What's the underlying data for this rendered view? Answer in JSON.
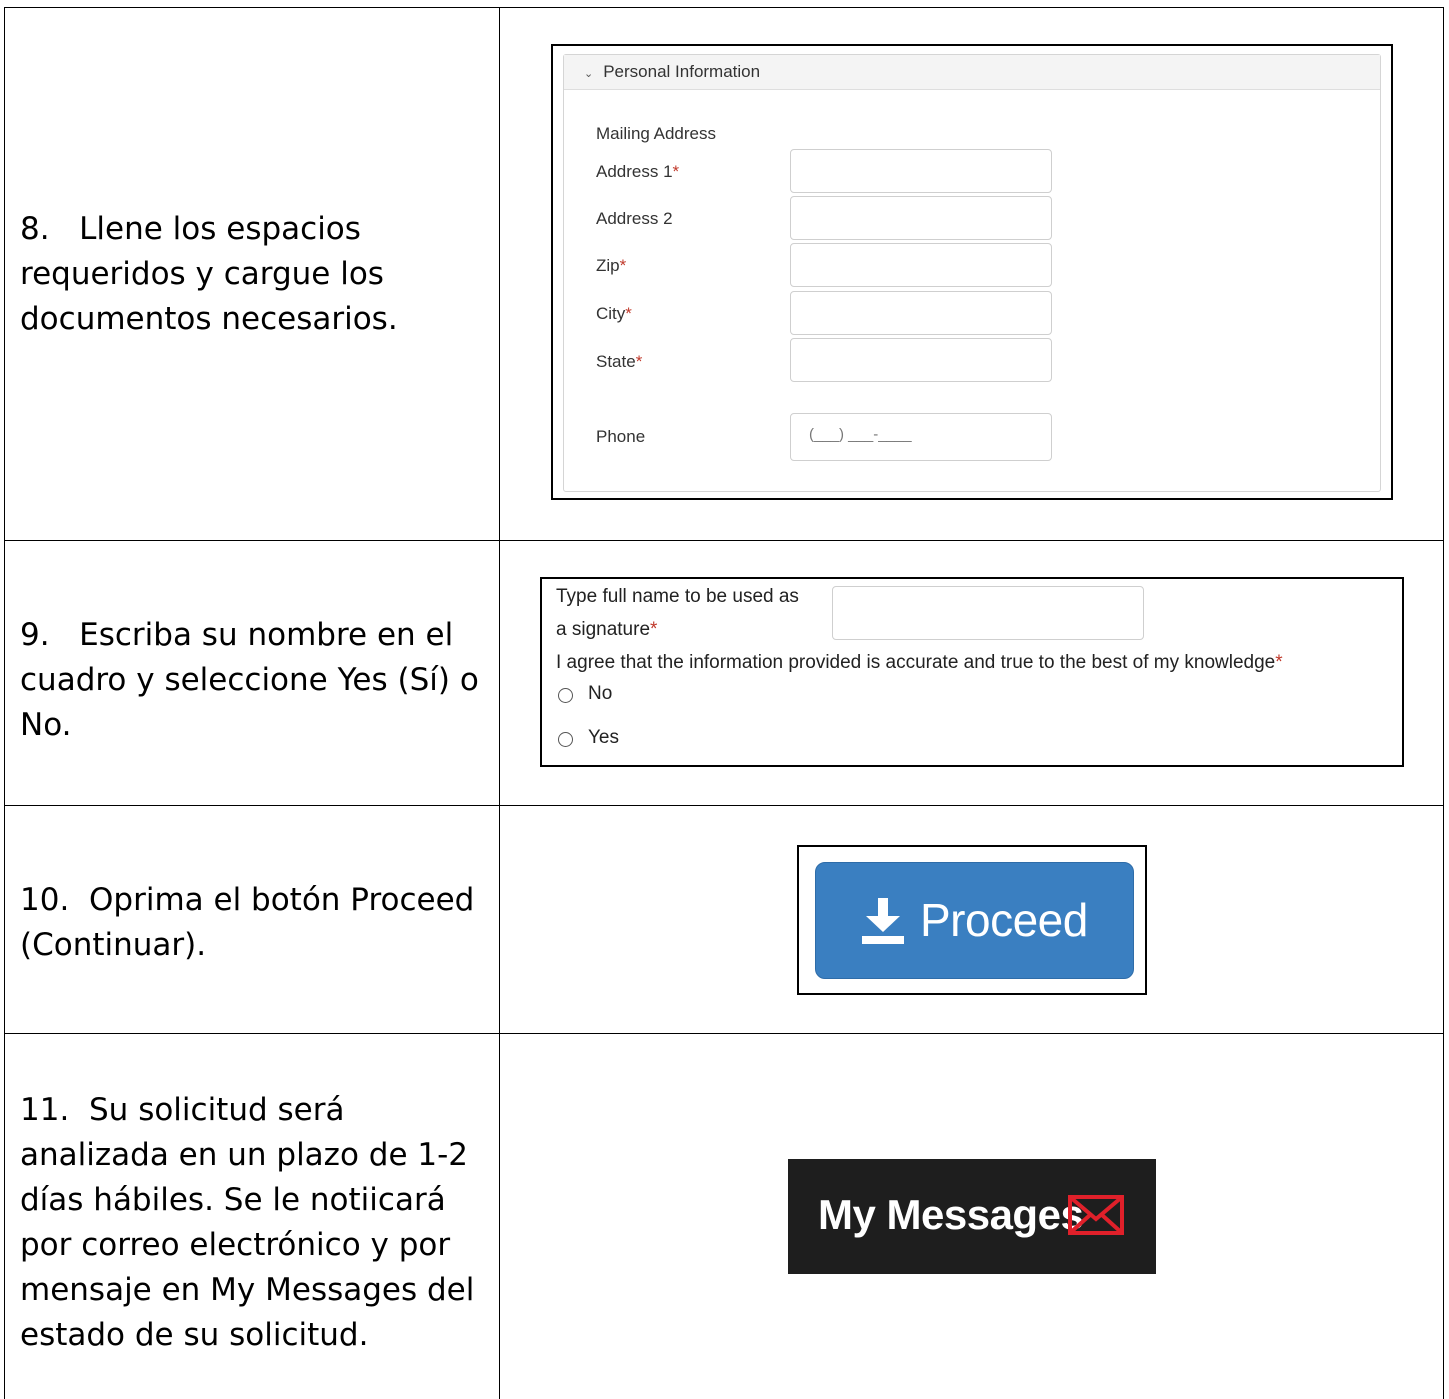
{
  "steps": [
    {
      "text": "8.   Llene los espacios requeridos y cargue los documentos necesarios."
    },
    {
      "text": "9.   Escriba su nombre en el cuadro y seleccione Yes (Sí) o No."
    },
    {
      "text": "10.  Oprima el botón Proceed (Continuar)."
    },
    {
      "text": "11.  Su solicitud será analizada en un plazo de 1-2 días hábiles. Se le notiicará por correo electrónico y por mensaje en My Messages del estado de su solicitud."
    }
  ],
  "personal_info": {
    "header": "Personal Information",
    "section_label": "Mailing Address",
    "fields": {
      "address1": "Address 1",
      "address2": "Address 2",
      "zip": "Zip",
      "city": "City",
      "state": "State",
      "phone": "Phone"
    },
    "required_mark": "*",
    "phone_placeholder": "(___) ___-____"
  },
  "signature": {
    "label_line1": "Type full name to be used as",
    "label_line2": "a signature",
    "agree_text": "I agree that the information provided is accurate and true to the best of my knowledge",
    "required_mark": "*",
    "options": [
      "No",
      "Yes"
    ]
  },
  "proceed_button": {
    "label": "Proceed",
    "icon": "download-icon",
    "color": "#3a7fc1"
  },
  "my_messages": {
    "label": "My Messages",
    "icon": "envelope-icon",
    "icon_color": "#e0202a"
  }
}
